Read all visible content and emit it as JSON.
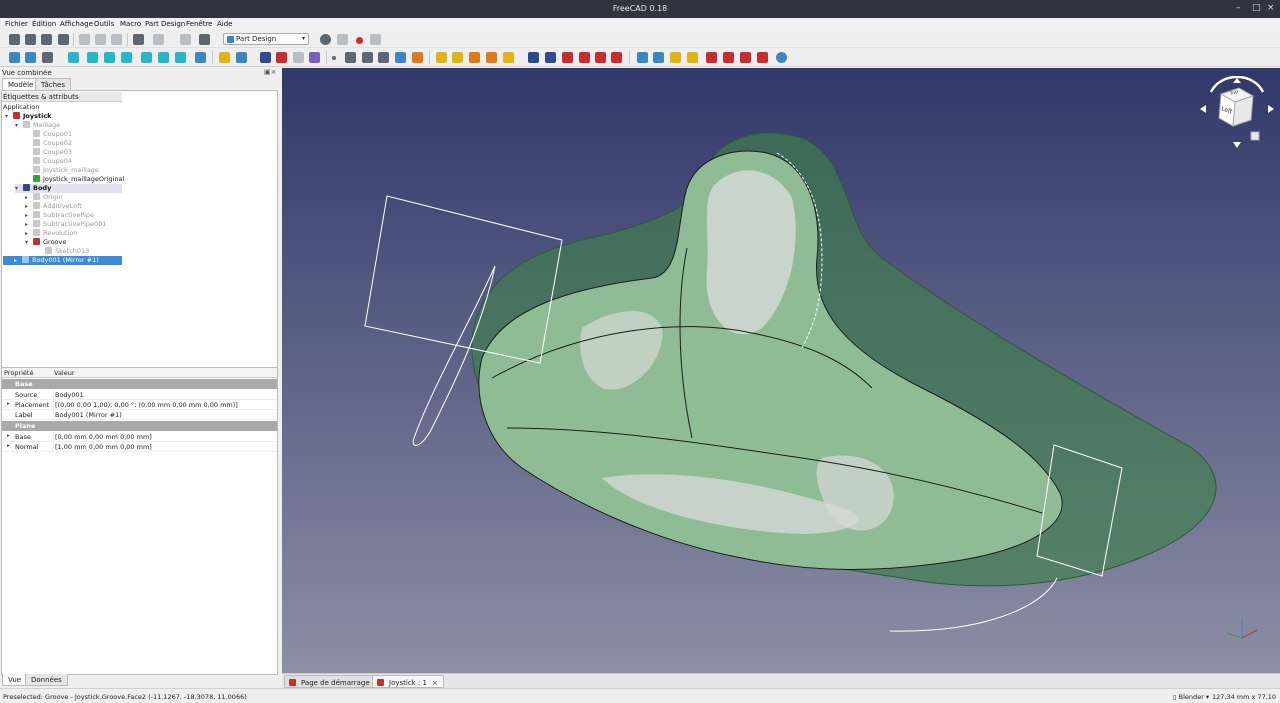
{
  "window": {
    "title": "FreeCAD 0.18"
  },
  "menu": [
    "Fichier",
    "Édition",
    "Affichage",
    "Outils",
    "Macro",
    "Part Design",
    "Fenêtre",
    "Aide"
  ],
  "workbench": {
    "selected": "Part Design"
  },
  "combo_view": {
    "title": "Vue combinée",
    "tabs": [
      "Modèle",
      "Tâches"
    ],
    "tree_header": "Étiquettes & attributs",
    "tree": [
      {
        "label": "Application"
      },
      {
        "label": "Joystick",
        "icon": "document-icon"
      },
      {
        "label": "Maillage",
        "icon": "folder-icon"
      },
      {
        "label": "Coupe01",
        "icon": "mesh-icon"
      },
      {
        "label": "Coupe02",
        "icon": "mesh-icon"
      },
      {
        "label": "Coupe03",
        "icon": "mesh-icon"
      },
      {
        "label": "Coupe04",
        "icon": "mesh-icon"
      },
      {
        "label": "Joystick_maillage",
        "icon": "mesh-icon"
      },
      {
        "label": "Joystick_maillageOriginal",
        "icon": "mesh-icon"
      },
      {
        "label": "Body",
        "icon": "body-icon"
      },
      {
        "label": "Origin",
        "icon": "origin-icon"
      },
      {
        "label": "AdditiveLoft",
        "icon": "loft-icon"
      },
      {
        "label": "SubtractivePipe",
        "icon": "pipe-icon"
      },
      {
        "label": "SubtractivePipe001",
        "icon": "pipe-icon"
      },
      {
        "label": "Revolution",
        "icon": "revolution-icon"
      },
      {
        "label": "Groove",
        "icon": "groove-icon"
      },
      {
        "label": "Sketch013",
        "icon": "sketch-icon"
      },
      {
        "label": "Body001 (Mirror #1)",
        "icon": "body-icon"
      }
    ],
    "properties": {
      "col_property": "Propriété",
      "col_value": "Valeur",
      "groups": [
        {
          "name": "Base",
          "rows": [
            {
              "key": "Source",
              "value": "Body001"
            },
            {
              "key": "Placement",
              "value": "[(0,00 0,00 1,00); 0,00 °; (0,00 mm  0,00 mm  0,00 mm)]"
            },
            {
              "key": "Label",
              "value": "Body001 (Mirror #1)"
            }
          ]
        },
        {
          "name": "Plane",
          "rows": [
            {
              "key": "Base",
              "value": "[0,00 mm  0,00 mm  0,00 mm]"
            },
            {
              "key": "Normal",
              "value": "[1,00 mm  0,00 mm  0,00 mm]"
            }
          ]
        }
      ]
    },
    "bottom_tabs": [
      "Vue",
      "Données"
    ]
  },
  "view_tabs": [
    "Page de démarrage",
    "Joystick : 1"
  ],
  "navcube": {
    "face": "Left",
    "top": "Top"
  },
  "status": {
    "message": "Preselected: Groove - Joystick.Groove.Face2 (-11.1267, -18.3078, 11.0066)",
    "navigation": "Blender",
    "dimensions": "127,34 mm x 77,10 mm"
  },
  "colors": {
    "viewport_top": "#31386a",
    "viewport_bottom": "#8c8fa5",
    "mesh": "#3f7f4c",
    "selection": "#3a8ad6"
  }
}
